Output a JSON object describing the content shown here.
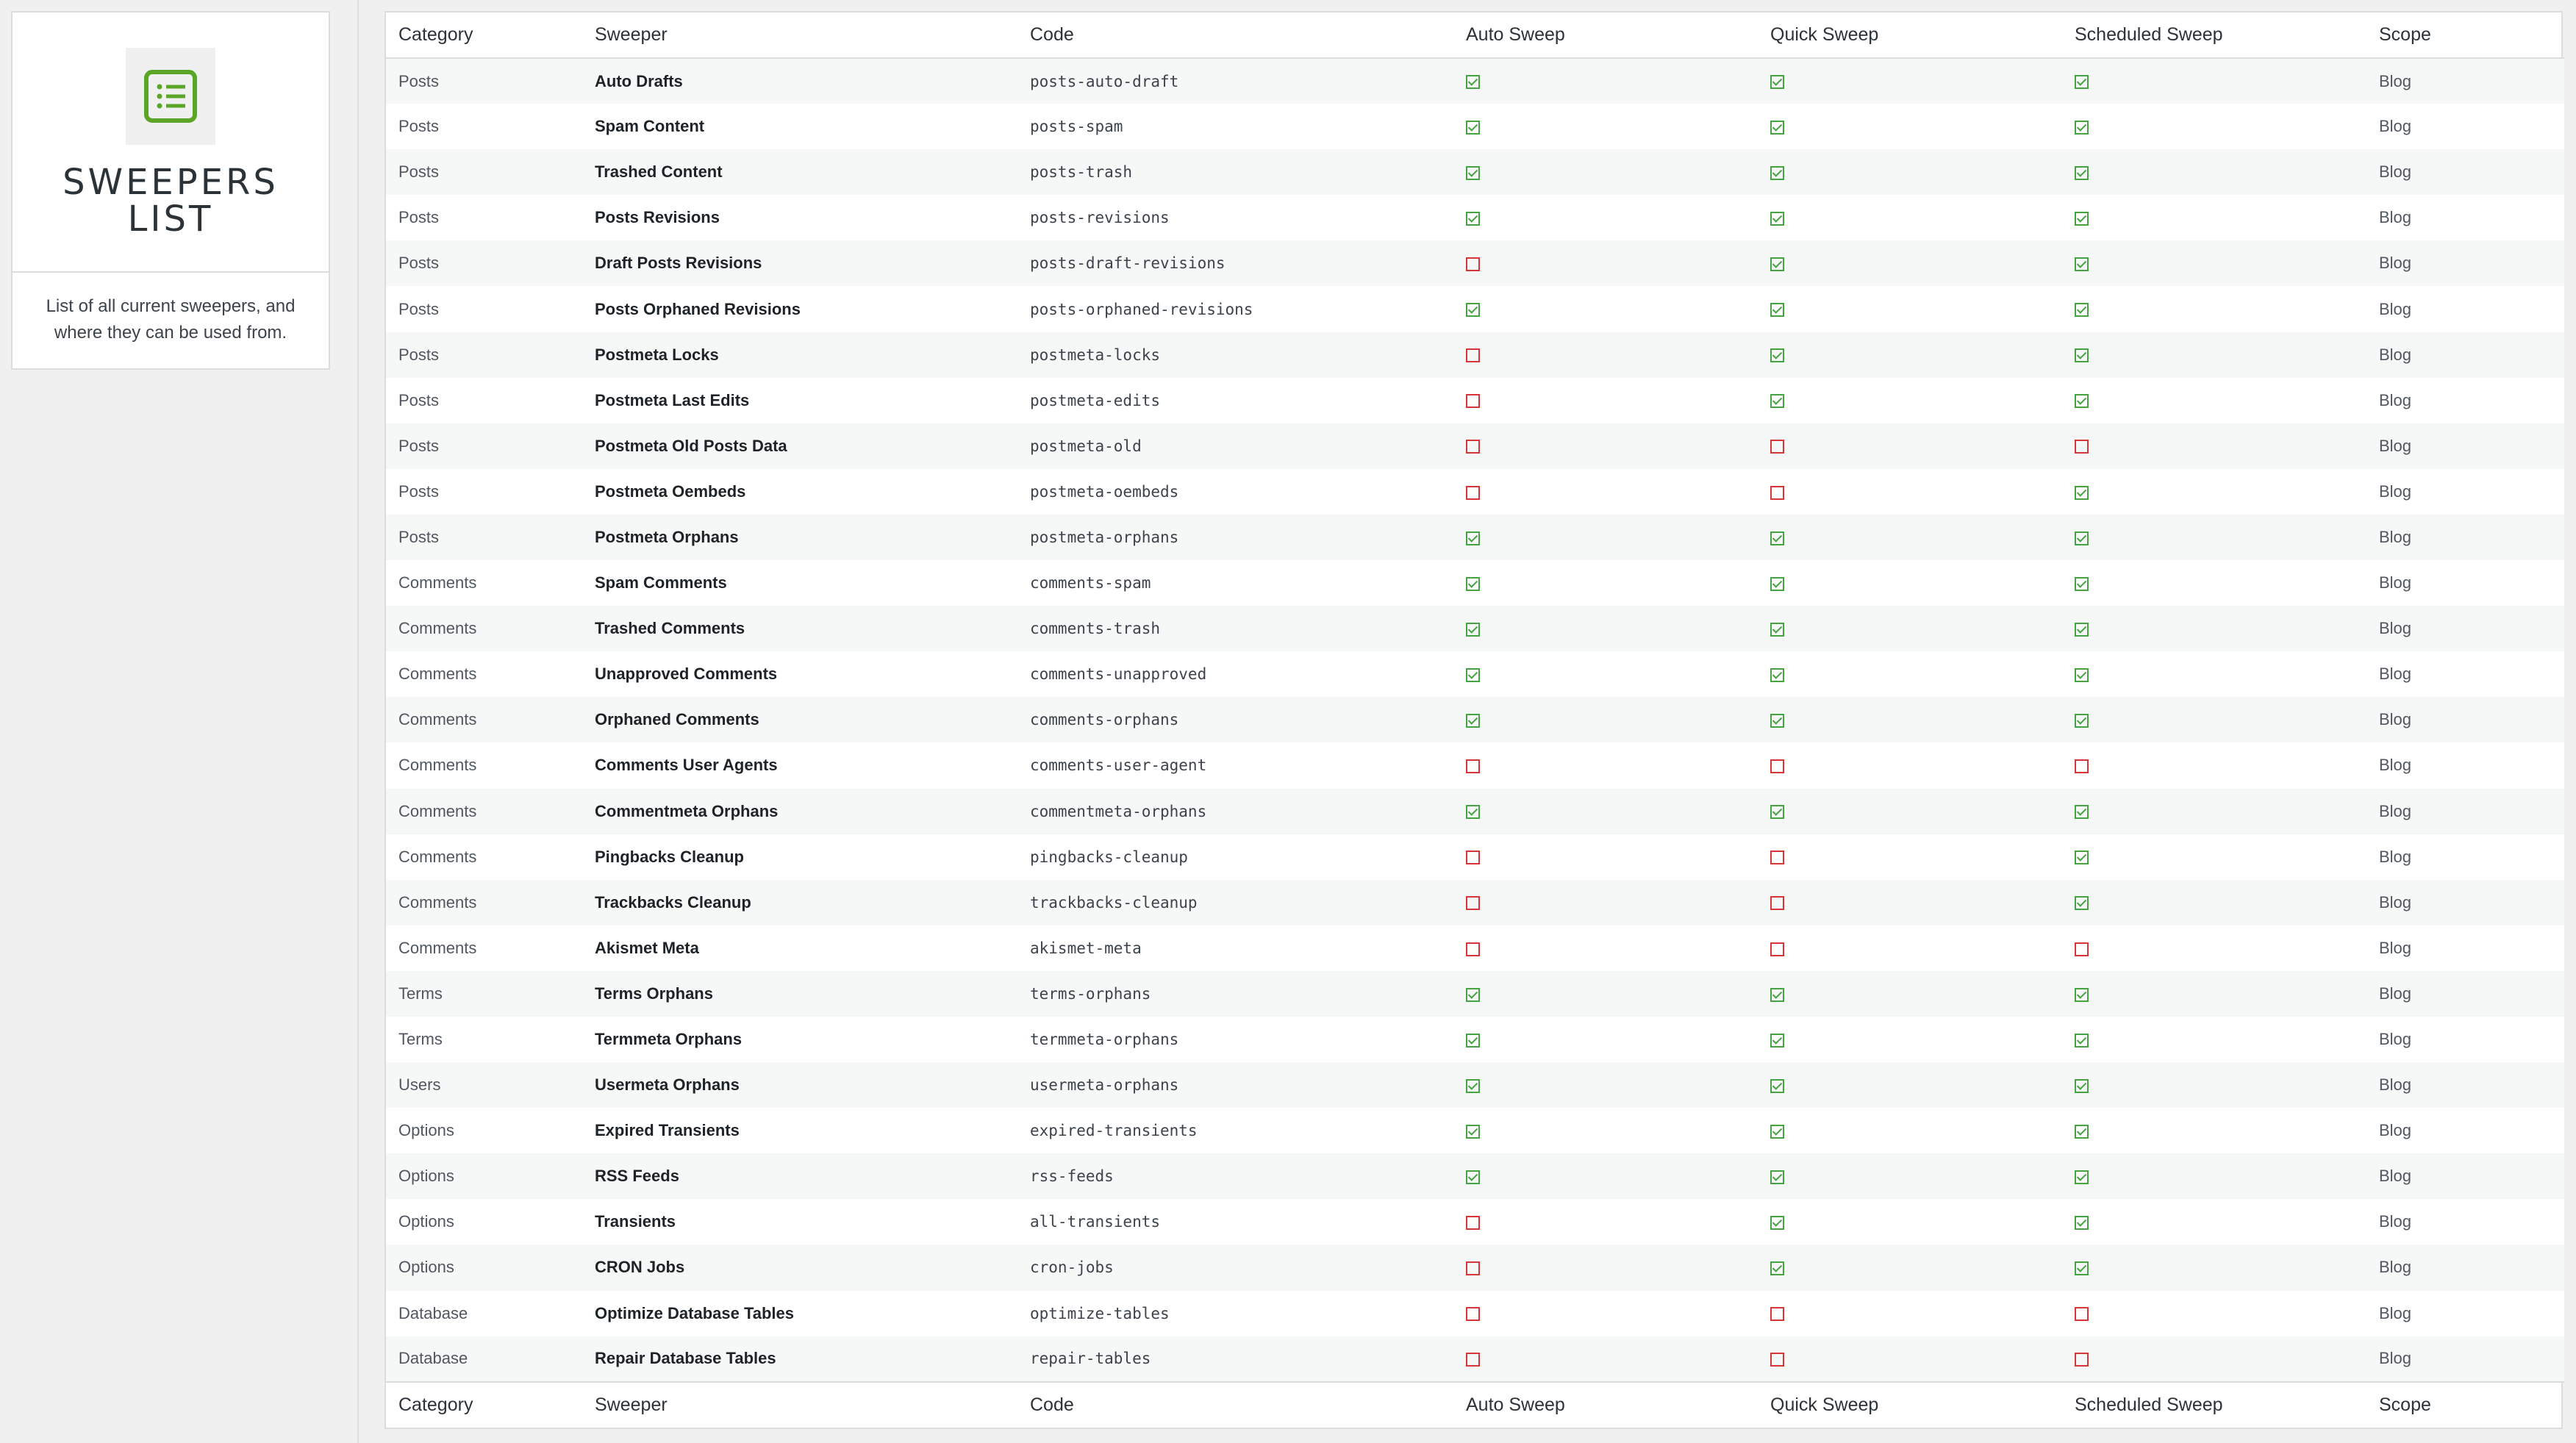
{
  "panel": {
    "title": "SWEEPERS LIST",
    "description": "List of all current sweepers, and where they can be used from.",
    "icon": "list-icon",
    "accent": "#5ba626"
  },
  "columns": [
    "Category",
    "Sweeper",
    "Code",
    "Auto Sweep",
    "Quick Sweep",
    "Scheduled Sweep",
    "Scope"
  ],
  "colors": {
    "enabled": "#46a341",
    "disabled": "#d63638"
  },
  "rows": [
    {
      "category": "Posts",
      "sweeper": "Auto Drafts",
      "code": "posts-auto-draft",
      "auto": true,
      "quick": true,
      "scheduled": true,
      "scope": "Blog"
    },
    {
      "category": "Posts",
      "sweeper": "Spam Content",
      "code": "posts-spam",
      "auto": true,
      "quick": true,
      "scheduled": true,
      "scope": "Blog"
    },
    {
      "category": "Posts",
      "sweeper": "Trashed Content",
      "code": "posts-trash",
      "auto": true,
      "quick": true,
      "scheduled": true,
      "scope": "Blog"
    },
    {
      "category": "Posts",
      "sweeper": "Posts Revisions",
      "code": "posts-revisions",
      "auto": true,
      "quick": true,
      "scheduled": true,
      "scope": "Blog"
    },
    {
      "category": "Posts",
      "sweeper": "Draft Posts Revisions",
      "code": "posts-draft-revisions",
      "auto": false,
      "quick": true,
      "scheduled": true,
      "scope": "Blog"
    },
    {
      "category": "Posts",
      "sweeper": "Posts Orphaned Revisions",
      "code": "posts-orphaned-revisions",
      "auto": true,
      "quick": true,
      "scheduled": true,
      "scope": "Blog"
    },
    {
      "category": "Posts",
      "sweeper": "Postmeta Locks",
      "code": "postmeta-locks",
      "auto": false,
      "quick": true,
      "scheduled": true,
      "scope": "Blog"
    },
    {
      "category": "Posts",
      "sweeper": "Postmeta Last Edits",
      "code": "postmeta-edits",
      "auto": false,
      "quick": true,
      "scheduled": true,
      "scope": "Blog"
    },
    {
      "category": "Posts",
      "sweeper": "Postmeta Old Posts Data",
      "code": "postmeta-old",
      "auto": false,
      "quick": false,
      "scheduled": false,
      "scope": "Blog"
    },
    {
      "category": "Posts",
      "sweeper": "Postmeta Oembeds",
      "code": "postmeta-oembeds",
      "auto": false,
      "quick": false,
      "scheduled": true,
      "scope": "Blog"
    },
    {
      "category": "Posts",
      "sweeper": "Postmeta Orphans",
      "code": "postmeta-orphans",
      "auto": true,
      "quick": true,
      "scheduled": true,
      "scope": "Blog"
    },
    {
      "category": "Comments",
      "sweeper": "Spam Comments",
      "code": "comments-spam",
      "auto": true,
      "quick": true,
      "scheduled": true,
      "scope": "Blog"
    },
    {
      "category": "Comments",
      "sweeper": "Trashed Comments",
      "code": "comments-trash",
      "auto": true,
      "quick": true,
      "scheduled": true,
      "scope": "Blog"
    },
    {
      "category": "Comments",
      "sweeper": "Unapproved Comments",
      "code": "comments-unapproved",
      "auto": true,
      "quick": true,
      "scheduled": true,
      "scope": "Blog"
    },
    {
      "category": "Comments",
      "sweeper": "Orphaned Comments",
      "code": "comments-orphans",
      "auto": true,
      "quick": true,
      "scheduled": true,
      "scope": "Blog"
    },
    {
      "category": "Comments",
      "sweeper": "Comments User Agents",
      "code": "comments-user-agent",
      "auto": false,
      "quick": false,
      "scheduled": false,
      "scope": "Blog"
    },
    {
      "category": "Comments",
      "sweeper": "Commentmeta Orphans",
      "code": "commentmeta-orphans",
      "auto": true,
      "quick": true,
      "scheduled": true,
      "scope": "Blog"
    },
    {
      "category": "Comments",
      "sweeper": "Pingbacks Cleanup",
      "code": "pingbacks-cleanup",
      "auto": false,
      "quick": false,
      "scheduled": true,
      "scope": "Blog"
    },
    {
      "category": "Comments",
      "sweeper": "Trackbacks Cleanup",
      "code": "trackbacks-cleanup",
      "auto": false,
      "quick": false,
      "scheduled": true,
      "scope": "Blog"
    },
    {
      "category": "Comments",
      "sweeper": "Akismet Meta",
      "code": "akismet-meta",
      "auto": false,
      "quick": false,
      "scheduled": false,
      "scope": "Blog"
    },
    {
      "category": "Terms",
      "sweeper": "Terms Orphans",
      "code": "terms-orphans",
      "auto": true,
      "quick": true,
      "scheduled": true,
      "scope": "Blog"
    },
    {
      "category": "Terms",
      "sweeper": "Termmeta Orphans",
      "code": "termmeta-orphans",
      "auto": true,
      "quick": true,
      "scheduled": true,
      "scope": "Blog"
    },
    {
      "category": "Users",
      "sweeper": "Usermeta Orphans",
      "code": "usermeta-orphans",
      "auto": true,
      "quick": true,
      "scheduled": true,
      "scope": "Blog"
    },
    {
      "category": "Options",
      "sweeper": "Expired Transients",
      "code": "expired-transients",
      "auto": true,
      "quick": true,
      "scheduled": true,
      "scope": "Blog"
    },
    {
      "category": "Options",
      "sweeper": "RSS Feeds",
      "code": "rss-feeds",
      "auto": true,
      "quick": true,
      "scheduled": true,
      "scope": "Blog"
    },
    {
      "category": "Options",
      "sweeper": "Transients",
      "code": "all-transients",
      "auto": false,
      "quick": true,
      "scheduled": true,
      "scope": "Blog"
    },
    {
      "category": "Options",
      "sweeper": "CRON Jobs",
      "code": "cron-jobs",
      "auto": false,
      "quick": true,
      "scheduled": true,
      "scope": "Blog"
    },
    {
      "category": "Database",
      "sweeper": "Optimize Database Tables",
      "code": "optimize-tables",
      "auto": false,
      "quick": false,
      "scheduled": false,
      "scope": "Blog"
    },
    {
      "category": "Database",
      "sweeper": "Repair Database Tables",
      "code": "repair-tables",
      "auto": false,
      "quick": false,
      "scheduled": false,
      "scope": "Blog"
    }
  ]
}
